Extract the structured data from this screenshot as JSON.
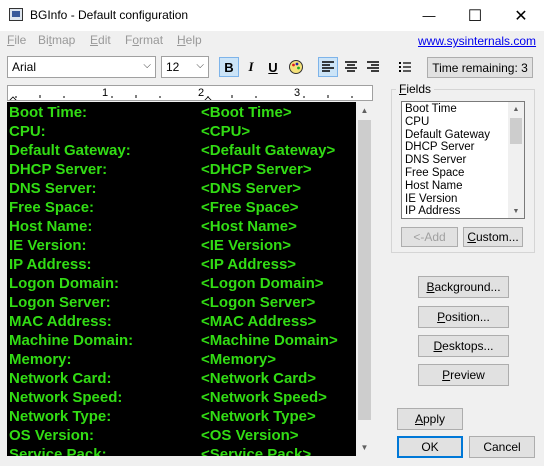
{
  "window": {
    "title": "BGInfo - Default configuration",
    "minimize_icon": "minimize-icon",
    "maximize_icon": "maximize-icon",
    "close_icon": "close-icon",
    "min_glyph": "—",
    "max_glyph": "☐",
    "close_glyph": "✕"
  },
  "menu": {
    "items": [
      "File",
      "Bitmap",
      "Edit",
      "Format",
      "Help"
    ],
    "link": "www.sysinternals.com"
  },
  "toolbar": {
    "font": "Arial",
    "size": "12",
    "bold": "B",
    "italic": "I",
    "underline": "U",
    "time_remaining": "Time remaining: 3",
    "align_left_on": true
  },
  "ruler": {
    "marks": [
      "1",
      "2",
      "3"
    ]
  },
  "editor": {
    "text_color": "#32dc14",
    "rows": [
      {
        "label": "Boot Time:",
        "value": "<Boot Time>"
      },
      {
        "label": "CPU:",
        "value": "<CPU>"
      },
      {
        "label": "Default Gateway:",
        "value": "<Default Gateway>"
      },
      {
        "label": "DHCP Server:",
        "value": "<DHCP Server>"
      },
      {
        "label": "DNS Server:",
        "value": "<DNS Server>"
      },
      {
        "label": "Free Space:",
        "value": "<Free Space>"
      },
      {
        "label": "Host Name:",
        "value": "<Host Name>"
      },
      {
        "label": "IE Version:",
        "value": "<IE Version>"
      },
      {
        "label": "IP Address:",
        "value": "<IP Address>"
      },
      {
        "label": "Logon Domain:",
        "value": "<Logon Domain>"
      },
      {
        "label": "Logon Server:",
        "value": "<Logon Server>"
      },
      {
        "label": "MAC Address:",
        "value": "<MAC Address>"
      },
      {
        "label": "Machine Domain:",
        "value": "<Machine Domain>"
      },
      {
        "label": "Memory:",
        "value": "<Memory>"
      },
      {
        "label": "Network Card:",
        "value": "<Network Card>"
      },
      {
        "label": "Network Speed:",
        "value": "<Network Speed>"
      },
      {
        "label": "Network Type:",
        "value": "<Network Type>"
      },
      {
        "label": "OS Version:",
        "value": "<OS Version>"
      },
      {
        "label": "Service Pack:",
        "value": "<Service Pack>"
      }
    ]
  },
  "fields": {
    "label": "Fields",
    "items": [
      "Boot Time",
      "CPU",
      "Default Gateway",
      "DHCP Server",
      "DNS Server",
      "Free Space",
      "Host Name",
      "IE Version",
      "IP Address"
    ],
    "add_button": "<-Add",
    "custom_button": "Custom..."
  },
  "buttons": {
    "background": "Background...",
    "position": "Position...",
    "desktops": "Desktops...",
    "preview": "Preview",
    "apply": "Apply",
    "ok": "OK",
    "cancel": "Cancel"
  }
}
